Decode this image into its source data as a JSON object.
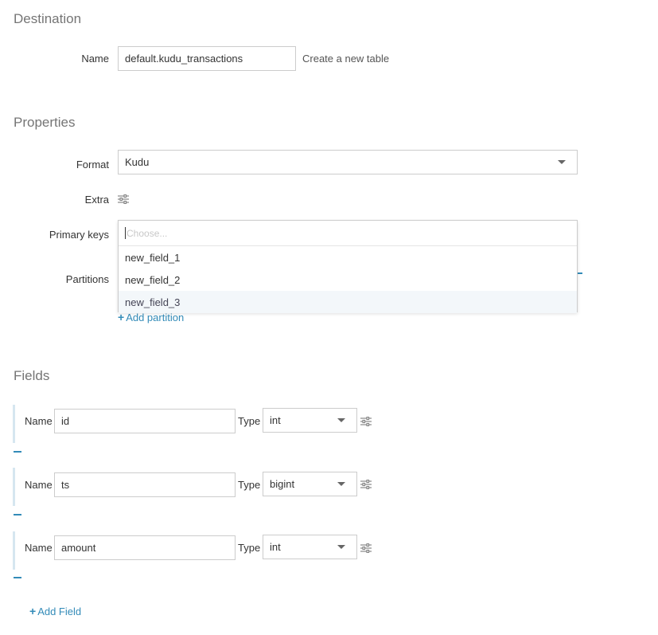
{
  "destination": {
    "title": "Destination",
    "name_label": "Name",
    "name_value": "default.kudu_transactions",
    "hint": "Create a new table"
  },
  "properties": {
    "title": "Properties",
    "format_label": "Format",
    "format_value": "Kudu",
    "extra_label": "Extra",
    "primary_keys_label": "Primary keys",
    "primary_keys_placeholder": "Choose...",
    "primary_key_options": [
      "new_field_1",
      "new_field_2",
      "new_field_3"
    ],
    "partitions_label": "Partitions",
    "add_partition": "Add partition"
  },
  "fields": {
    "title": "Fields",
    "name_label": "Name",
    "type_label": "Type",
    "rows": [
      {
        "name": "id",
        "type": "int"
      },
      {
        "name": "ts",
        "type": "bigint"
      },
      {
        "name": "amount",
        "type": "int"
      }
    ],
    "add_field": "Add Field"
  },
  "colors": {
    "accent": "#338bb8",
    "highlight": "#f3f7fa"
  }
}
